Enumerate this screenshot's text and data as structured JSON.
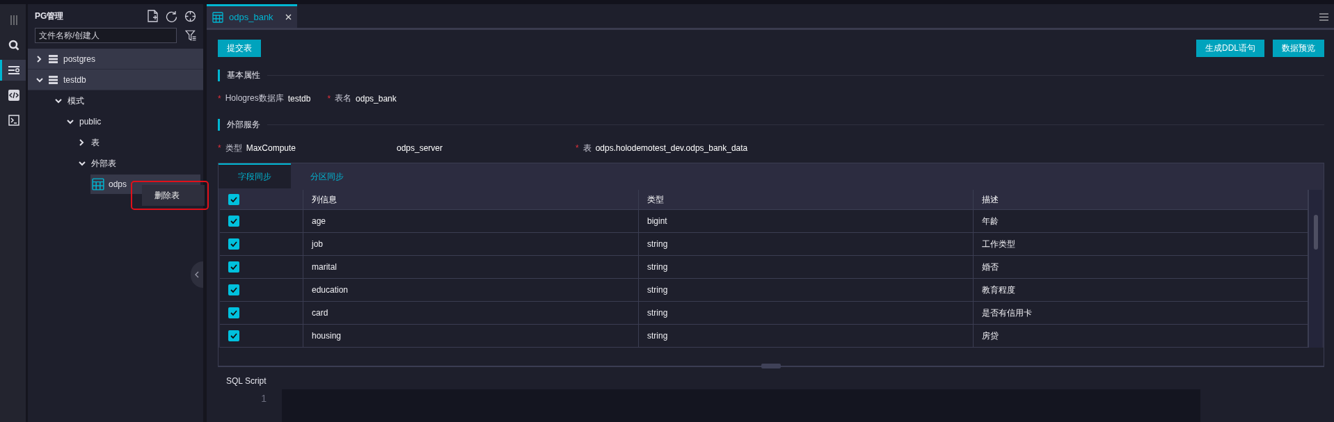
{
  "activity_bar": [
    {
      "selected": false
    },
    {
      "selected": true
    },
    {
      "selected": false
    },
    {
      "selected": false
    }
  ],
  "sidebar": {
    "title": "PG管理",
    "search": {
      "placeholder": "文件名称/创建人"
    },
    "tree": [
      {
        "label": "postgres",
        "kind": "database",
        "expanded": false
      },
      {
        "label": "testdb",
        "kind": "database",
        "expanded": true,
        "children": [
          {
            "label": "模式",
            "expanded": true,
            "children": [
              {
                "label": "public",
                "expanded": true,
                "children": [
                  {
                    "label": "表",
                    "expanded": false
                  },
                  {
                    "label": "外部表",
                    "expanded": true,
                    "children": [
                      {
                        "label": "odps",
                        "kind": "table",
                        "selected": true
                      }
                    ]
                  }
                ]
              }
            ]
          }
        ]
      }
    ],
    "context_menu": {
      "items": [
        "删除表"
      ]
    }
  },
  "tabs": [
    {
      "label": "odps_bank",
      "selected": true
    }
  ],
  "toolbar": {
    "left": [
      "提交表"
    ],
    "right": [
      "生成DDL语句",
      "数据预览"
    ]
  },
  "sections": [
    {
      "title": "基本属性",
      "fields": [
        {
          "mark": "*",
          "label": "Hologres数据库",
          "value": "testdb"
        },
        {
          "mark": "*",
          "label": "表名",
          "value": "odps_bank"
        }
      ]
    },
    {
      "title": "外部服务",
      "fields": [
        {
          "mark": "*",
          "label": "类型",
          "value": "MaxCompute"
        },
        {
          "value": "odps_server"
        },
        {
          "mark": "*",
          "label": "表",
          "value": "odps.holodemotest_dev.odps_bank_data"
        }
      ]
    }
  ],
  "sub_tabs": [
    {
      "label": "字段同步",
      "selected": true
    },
    {
      "label": "分区同步",
      "selected": false
    }
  ],
  "table": {
    "all_checked": true,
    "columns": [
      "列信息",
      "类型",
      "描述"
    ],
    "rows": [
      {
        "checked": true,
        "cells": [
          "age",
          "bigint",
          "年龄"
        ]
      },
      {
        "checked": true,
        "cells": [
          "job",
          "string",
          "工作类型"
        ]
      },
      {
        "checked": true,
        "cells": [
          "marital",
          "string",
          "婚否"
        ]
      },
      {
        "checked": true,
        "cells": [
          "education",
          "string",
          "教育程度"
        ]
      },
      {
        "checked": true,
        "cells": [
          "card",
          "string",
          "是否有信用卡"
        ]
      },
      {
        "checked": true,
        "cells": [
          "housing",
          "string",
          "房贷"
        ]
      }
    ]
  },
  "sql": {
    "title": "SQL Script",
    "line_numbers": [
      "1"
    ]
  }
}
